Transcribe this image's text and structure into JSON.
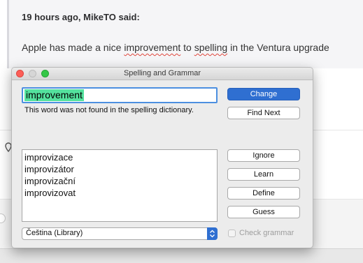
{
  "forum": {
    "quote_author": "19 hours ago, MikeTO said:",
    "quote_text_before": "Apple has made a nice ",
    "quote_text_misspelled_1": "improvement",
    "quote_text_middle": " to ",
    "quote_text_misspelled_2": "spelling",
    "quote_text_after": " in the Ventura upgrade"
  },
  "dialog": {
    "title": "Spelling and Grammar",
    "word": "improvement",
    "status_message": "This word was not found in the spelling dictionary.",
    "suggestions": [
      "improvizace",
      "improvizátor",
      "improvizační",
      "improvizovat"
    ],
    "buttons": {
      "change": "Change",
      "find_next": "Find Next",
      "ignore": "Ignore",
      "learn": "Learn",
      "define": "Define",
      "guess": "Guess"
    },
    "language": "Čeština (Library)",
    "check_grammar_label": "Check grammar",
    "check_grammar_checked": false
  },
  "colors": {
    "word_highlight": "#54e29e",
    "primary_button": "#2f6fd1",
    "spelling_squiggle": "#e0463b"
  }
}
